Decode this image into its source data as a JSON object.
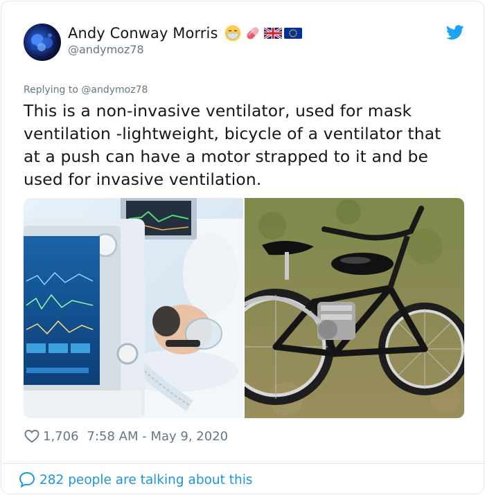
{
  "tweet": {
    "author": {
      "display_name": "Andy Conway Morris",
      "handle": "@andymoz78",
      "name_emojis": [
        "face-with-medical-mask",
        "pink-pill",
        "uk-flag",
        "eu-flag"
      ]
    },
    "replying_label": "Replying to ",
    "replying_to": "@andymoz78",
    "text": "This is a non-invasive ventilator, used for mask ventilation -lightweight, bicycle of a ventilator that at a push can have a motor strapped to it and be used for invasive ventilation.",
    "media": [
      {
        "description": "hospital-ventilator-photo"
      },
      {
        "description": "motorized-bicycle-photo"
      }
    ],
    "likes": "1,706",
    "timestamp": "7:58 AM - May 9, 2020",
    "conversation": "282 people are talking about this"
  },
  "colors": {
    "link": "#1b95e0",
    "muted": "#657786",
    "text": "#14171a",
    "border": "#e1e8ed",
    "twitter_blue": "#1da1f2"
  },
  "icons": [
    "twitter-bird-icon",
    "heart-icon",
    "speech-bubble-icon"
  ]
}
